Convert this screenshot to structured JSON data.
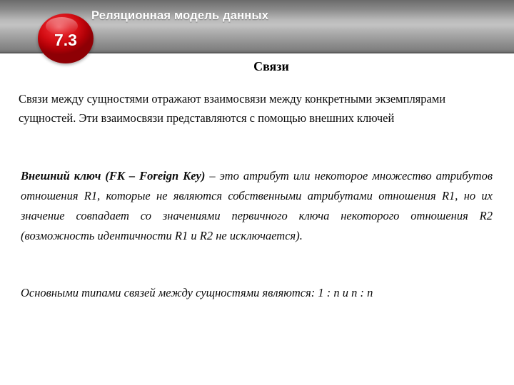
{
  "header": {
    "title": "Реляционная модель данных",
    "badge_number": "7.3",
    "badge_color": "#d30c12",
    "band_top_color": "#6b6b6b",
    "band_mid_color": "#c3c3c3",
    "band_bottom_color": "#6e6e6e"
  },
  "slide": {
    "heading": "Связи",
    "intro_paragraph": "Связи между сущностями отражают взаимосвязи между конкретными экземплярами сущностей. Эти взаимосвязи представляются с помощью внешних ключей",
    "definition": {
      "term": "Внешний ключ (FK – Foreign Key)",
      "body": " – это атрибут или некоторое множество атрибутов отношения R1, которые не являются собственными атрибутами отношения R1, но их значение совпадает со значениями первичного ключа некоторого отношения R2 (возможность идентичности R1 и R2 не исключается)."
    },
    "closing_paragraph": "Основными типами связей между сущностями являются: 1 : n и n : n"
  }
}
